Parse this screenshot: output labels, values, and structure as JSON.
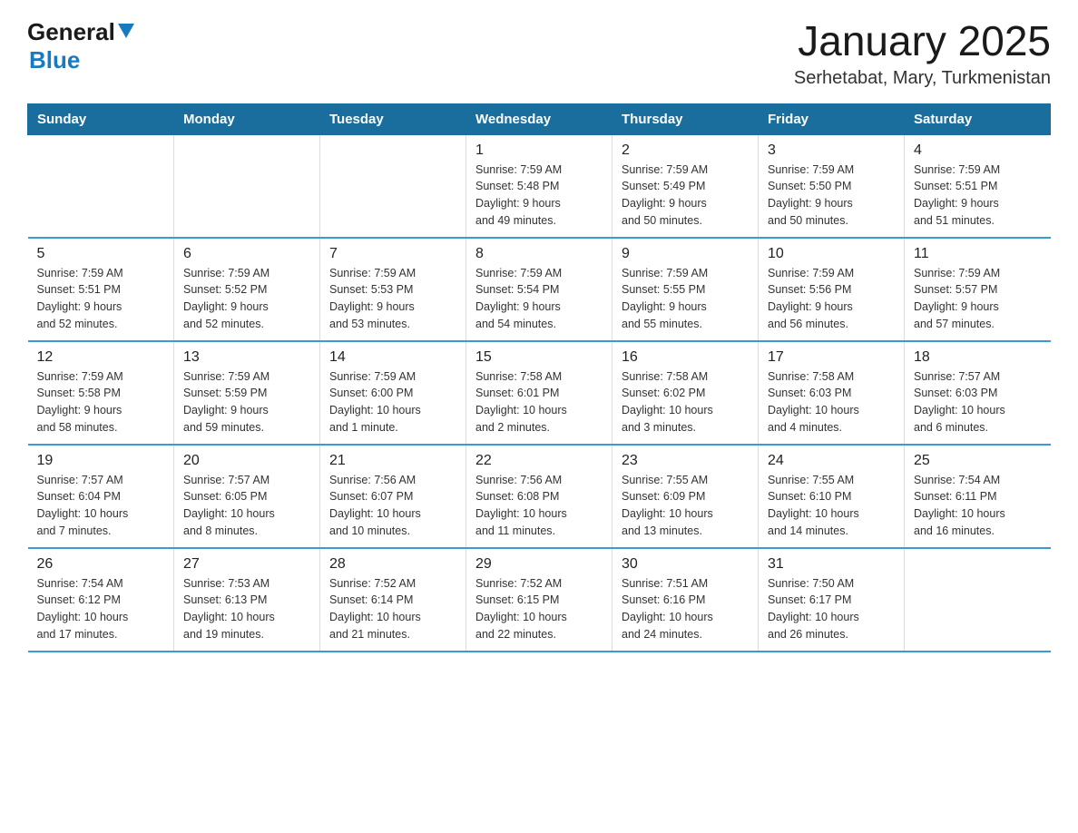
{
  "header": {
    "logo_general": "General",
    "logo_blue": "Blue",
    "title": "January 2025",
    "subtitle": "Serhetabat, Mary, Turkmenistan"
  },
  "days_of_week": [
    "Sunday",
    "Monday",
    "Tuesday",
    "Wednesday",
    "Thursday",
    "Friday",
    "Saturday"
  ],
  "weeks": [
    [
      {
        "day": "",
        "info": ""
      },
      {
        "day": "",
        "info": ""
      },
      {
        "day": "",
        "info": ""
      },
      {
        "day": "1",
        "info": "Sunrise: 7:59 AM\nSunset: 5:48 PM\nDaylight: 9 hours\nand 49 minutes."
      },
      {
        "day": "2",
        "info": "Sunrise: 7:59 AM\nSunset: 5:49 PM\nDaylight: 9 hours\nand 50 minutes."
      },
      {
        "day": "3",
        "info": "Sunrise: 7:59 AM\nSunset: 5:50 PM\nDaylight: 9 hours\nand 50 minutes."
      },
      {
        "day": "4",
        "info": "Sunrise: 7:59 AM\nSunset: 5:51 PM\nDaylight: 9 hours\nand 51 minutes."
      }
    ],
    [
      {
        "day": "5",
        "info": "Sunrise: 7:59 AM\nSunset: 5:51 PM\nDaylight: 9 hours\nand 52 minutes."
      },
      {
        "day": "6",
        "info": "Sunrise: 7:59 AM\nSunset: 5:52 PM\nDaylight: 9 hours\nand 52 minutes."
      },
      {
        "day": "7",
        "info": "Sunrise: 7:59 AM\nSunset: 5:53 PM\nDaylight: 9 hours\nand 53 minutes."
      },
      {
        "day": "8",
        "info": "Sunrise: 7:59 AM\nSunset: 5:54 PM\nDaylight: 9 hours\nand 54 minutes."
      },
      {
        "day": "9",
        "info": "Sunrise: 7:59 AM\nSunset: 5:55 PM\nDaylight: 9 hours\nand 55 minutes."
      },
      {
        "day": "10",
        "info": "Sunrise: 7:59 AM\nSunset: 5:56 PM\nDaylight: 9 hours\nand 56 minutes."
      },
      {
        "day": "11",
        "info": "Sunrise: 7:59 AM\nSunset: 5:57 PM\nDaylight: 9 hours\nand 57 minutes."
      }
    ],
    [
      {
        "day": "12",
        "info": "Sunrise: 7:59 AM\nSunset: 5:58 PM\nDaylight: 9 hours\nand 58 minutes."
      },
      {
        "day": "13",
        "info": "Sunrise: 7:59 AM\nSunset: 5:59 PM\nDaylight: 9 hours\nand 59 minutes."
      },
      {
        "day": "14",
        "info": "Sunrise: 7:59 AM\nSunset: 6:00 PM\nDaylight: 10 hours\nand 1 minute."
      },
      {
        "day": "15",
        "info": "Sunrise: 7:58 AM\nSunset: 6:01 PM\nDaylight: 10 hours\nand 2 minutes."
      },
      {
        "day": "16",
        "info": "Sunrise: 7:58 AM\nSunset: 6:02 PM\nDaylight: 10 hours\nand 3 minutes."
      },
      {
        "day": "17",
        "info": "Sunrise: 7:58 AM\nSunset: 6:03 PM\nDaylight: 10 hours\nand 4 minutes."
      },
      {
        "day": "18",
        "info": "Sunrise: 7:57 AM\nSunset: 6:03 PM\nDaylight: 10 hours\nand 6 minutes."
      }
    ],
    [
      {
        "day": "19",
        "info": "Sunrise: 7:57 AM\nSunset: 6:04 PM\nDaylight: 10 hours\nand 7 minutes."
      },
      {
        "day": "20",
        "info": "Sunrise: 7:57 AM\nSunset: 6:05 PM\nDaylight: 10 hours\nand 8 minutes."
      },
      {
        "day": "21",
        "info": "Sunrise: 7:56 AM\nSunset: 6:07 PM\nDaylight: 10 hours\nand 10 minutes."
      },
      {
        "day": "22",
        "info": "Sunrise: 7:56 AM\nSunset: 6:08 PM\nDaylight: 10 hours\nand 11 minutes."
      },
      {
        "day": "23",
        "info": "Sunrise: 7:55 AM\nSunset: 6:09 PM\nDaylight: 10 hours\nand 13 minutes."
      },
      {
        "day": "24",
        "info": "Sunrise: 7:55 AM\nSunset: 6:10 PM\nDaylight: 10 hours\nand 14 minutes."
      },
      {
        "day": "25",
        "info": "Sunrise: 7:54 AM\nSunset: 6:11 PM\nDaylight: 10 hours\nand 16 minutes."
      }
    ],
    [
      {
        "day": "26",
        "info": "Sunrise: 7:54 AM\nSunset: 6:12 PM\nDaylight: 10 hours\nand 17 minutes."
      },
      {
        "day": "27",
        "info": "Sunrise: 7:53 AM\nSunset: 6:13 PM\nDaylight: 10 hours\nand 19 minutes."
      },
      {
        "day": "28",
        "info": "Sunrise: 7:52 AM\nSunset: 6:14 PM\nDaylight: 10 hours\nand 21 minutes."
      },
      {
        "day": "29",
        "info": "Sunrise: 7:52 AM\nSunset: 6:15 PM\nDaylight: 10 hours\nand 22 minutes."
      },
      {
        "day": "30",
        "info": "Sunrise: 7:51 AM\nSunset: 6:16 PM\nDaylight: 10 hours\nand 24 minutes."
      },
      {
        "day": "31",
        "info": "Sunrise: 7:50 AM\nSunset: 6:17 PM\nDaylight: 10 hours\nand 26 minutes."
      },
      {
        "day": "",
        "info": ""
      }
    ]
  ]
}
